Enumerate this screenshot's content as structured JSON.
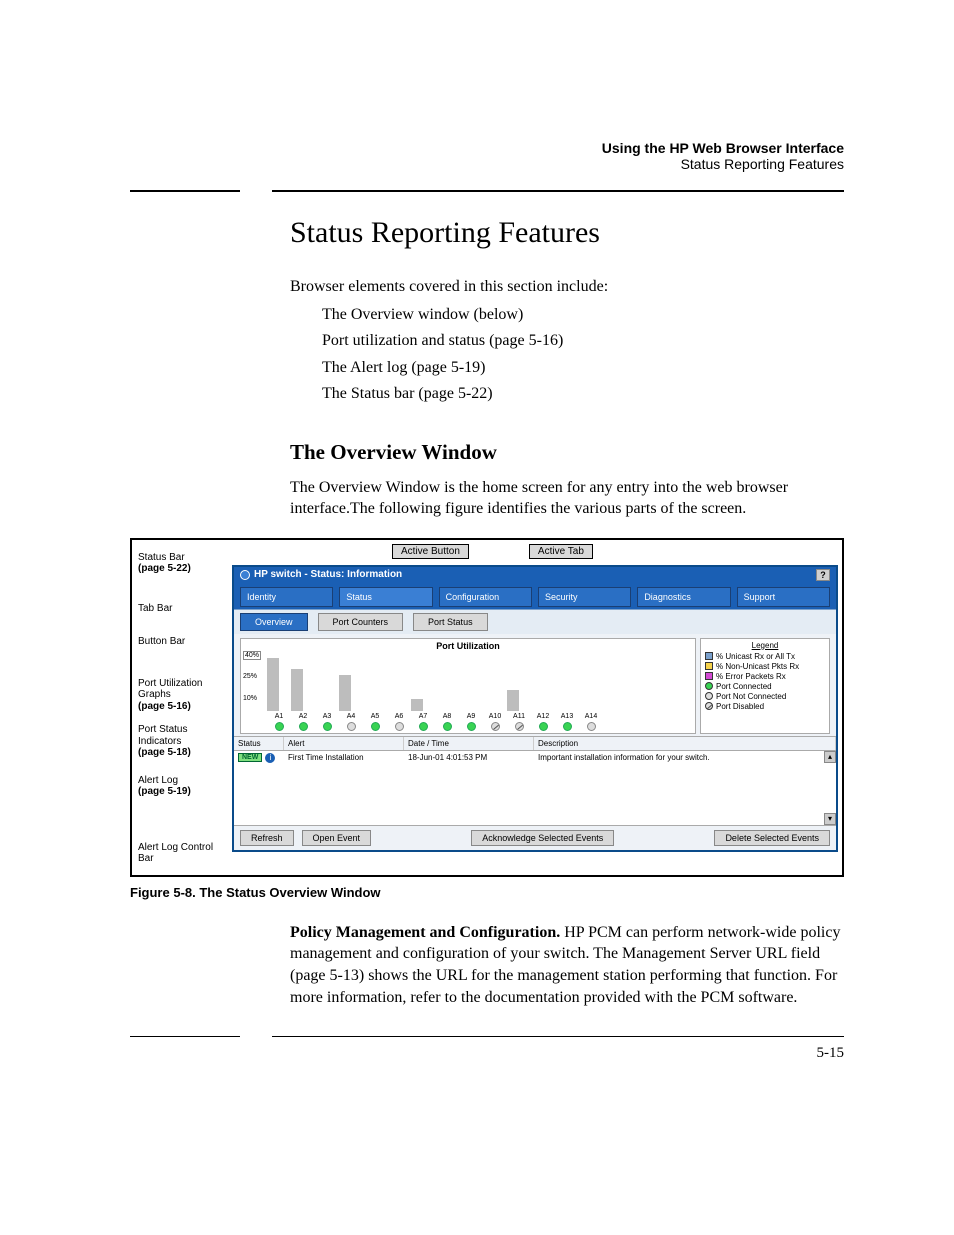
{
  "header": {
    "title": "Using the HP Web Browser Interface",
    "subtitle": "Status Reporting Features"
  },
  "h1": "Status Reporting Features",
  "intro": "Browser elements covered in this section include:",
  "bullets": {
    "b1": "The Overview window (below)",
    "b2": "Port utilization and status (page 5-16)",
    "b3": "The Alert log (page 5-19)",
    "b4": "The Status bar (page 5-22)"
  },
  "h2": "The Overview Window",
  "overview_p": "The Overview Window is the home screen for any entry into the web browser interface.The following figure identifies the various parts of the screen.",
  "labels": {
    "status_bar": "Status Bar",
    "status_bar_ref": "(page 5-22)",
    "tab_bar": "Tab Bar",
    "button_bar": "Button Bar",
    "port_util": "Port Utiliza­tion Graphs",
    "port_util_ref": "(page 5-16)",
    "port_status": "Port Status Indicators",
    "port_status_ref": "(page 5-18)",
    "alert_log": "Alert Log",
    "alert_log_ref": "(page 5-19)",
    "alert_ctrl": "Alert Log Control Bar"
  },
  "callouts": {
    "active_button": "Active Button",
    "active_tab": "Active Tab"
  },
  "app": {
    "title": "HP switch - Status: Information",
    "help_q": "?",
    "tabs": {
      "identity": "Identity",
      "status": "Status",
      "configuration": "Configuration",
      "security": "Security",
      "diagnostics": "Diagnostics",
      "support": "Support"
    },
    "buttons": {
      "overview": "Overview",
      "port_counters": "Port Counters",
      "port_status": "Port Status"
    },
    "chart_title": "Port Utilization",
    "legend_title": "Legend",
    "legend": {
      "unicast": "% Unicast Rx or All Tx",
      "non_unicast": "% Non-Unicast Pkts Rx",
      "errors": "% Error Packets Rx",
      "connected": "Port Connected",
      "not_connected": "Port Not Connected",
      "disabled": "Port Disabled"
    },
    "alert_cols": {
      "status": "Status",
      "alert": "Alert",
      "datetime": "Date / Time",
      "description": "Description"
    },
    "alert_row": {
      "new": "NEW",
      "alert": "First Time Installation",
      "datetime": "18-Jun-01 4:01:53 PM",
      "description": "Important installation information for your switch."
    },
    "controls": {
      "refresh": "Refresh",
      "open": "Open Event",
      "ack": "Acknowledge Selected Events",
      "del": "Delete Selected Events"
    }
  },
  "chart_data": {
    "type": "bar",
    "title": "Port Utilization",
    "ylabel": "%",
    "ylim": [
      0,
      40
    ],
    "yticks": [
      10,
      25,
      40
    ],
    "categories": [
      "A1",
      "A2",
      "A3",
      "A4",
      "A5",
      "A6",
      "A7",
      "A8",
      "A9",
      "A10",
      "A11",
      "A12",
      "A13",
      "A14"
    ],
    "values": [
      35,
      28,
      0,
      24,
      0,
      0,
      8,
      0,
      0,
      0,
      14,
      0,
      0,
      0
    ],
    "port_status": [
      "green",
      "green",
      "green",
      "grey",
      "green",
      "grey",
      "green",
      "green",
      "green",
      "slash",
      "slash",
      "green",
      "green",
      "grey"
    ]
  },
  "fig_caption": "Figure 5-8.   The Status Overview Window",
  "policy_bold": "Policy Management and Configuration.",
  "policy_body": "  HP PCM can perform network-wide policy management and configuration of your switch. The Management Server URL field (page 5-13) shows the URL for the management station performing that function. For more information, refer to the documentation provided with the PCM software.",
  "page_number": "5-15"
}
